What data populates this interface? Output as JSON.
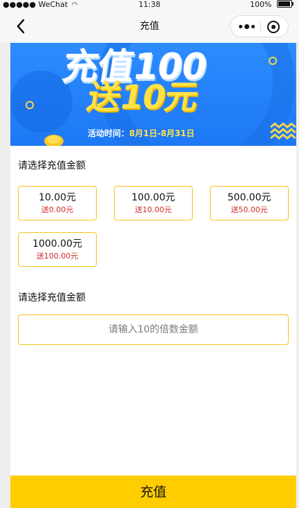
{
  "status_bar": {
    "carrier": "●●●●● WeChat",
    "time": "11:38",
    "battery": "100%"
  },
  "nav": {
    "title": "充值"
  },
  "banner": {
    "main_text": "充值100",
    "gift_text": "送10元",
    "period_label": "活动时间：",
    "period_date": "8月1日-8月31日"
  },
  "section_amounts": {
    "title": "请选择充值金额"
  },
  "amounts": [
    {
      "value": "10.00元",
      "bonus": "送0.00元"
    },
    {
      "value": "100.00元",
      "bonus": "送10.00元"
    },
    {
      "value": "500.00元",
      "bonus": "送50.00元"
    },
    {
      "value": "1000.00元",
      "bonus": "送100.00元"
    }
  ],
  "section_custom": {
    "title": "请选择充值金额",
    "placeholder": "请输入10的倍数金额",
    "value": ""
  },
  "submit": {
    "label": "充值"
  },
  "colors": {
    "accent": "#ffcd00",
    "border": "#f4c318",
    "bonus": "#d12b25",
    "banner_blue": "#2d8cff"
  }
}
